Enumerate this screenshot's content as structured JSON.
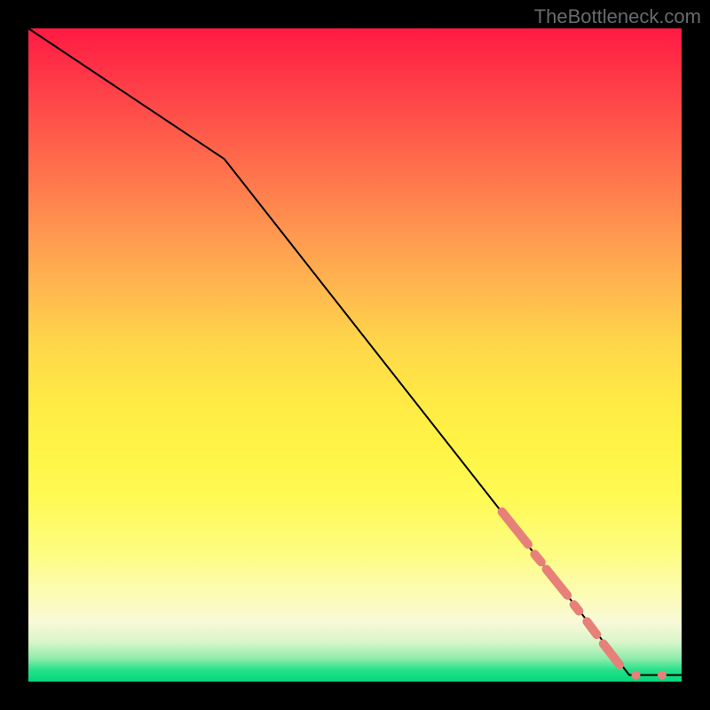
{
  "watermark": "TheBottleneck.com",
  "colors": {
    "marker": "#e78079",
    "curve": "#000000",
    "frame": "#000000"
  },
  "chart_data": {
    "type": "line",
    "title": "",
    "xlabel": "",
    "ylabel": "",
    "xlim": [
      0,
      100
    ],
    "ylim": [
      0,
      100
    ],
    "grid": false,
    "series": [
      {
        "name": "bottleneck-curve",
        "x": [
          0,
          30,
          85,
          92,
          100
        ],
        "y": [
          100,
          80,
          10,
          1,
          1
        ]
      }
    ],
    "markers": {
      "name": "highlight-segments",
      "style": "dashed-points",
      "segments": [
        {
          "x1": 72.5,
          "y1": 26.0,
          "x2": 76.5,
          "y2": 21.0
        },
        {
          "x1": 77.5,
          "y1": 19.5,
          "x2": 78.5,
          "y2": 18.3
        },
        {
          "x1": 79.3,
          "y1": 17.2,
          "x2": 82.5,
          "y2": 13.2
        },
        {
          "x1": 83.5,
          "y1": 11.8,
          "x2": 84.3,
          "y2": 10.8
        },
        {
          "x1": 85.5,
          "y1": 9.2,
          "x2": 87.0,
          "y2": 7.2
        },
        {
          "x1": 88.0,
          "y1": 5.8,
          "x2": 90.5,
          "y2": 2.6
        }
      ],
      "points": [
        {
          "x": 93.0,
          "y": 1.0
        },
        {
          "x": 97.0,
          "y": 1.0
        }
      ]
    }
  }
}
